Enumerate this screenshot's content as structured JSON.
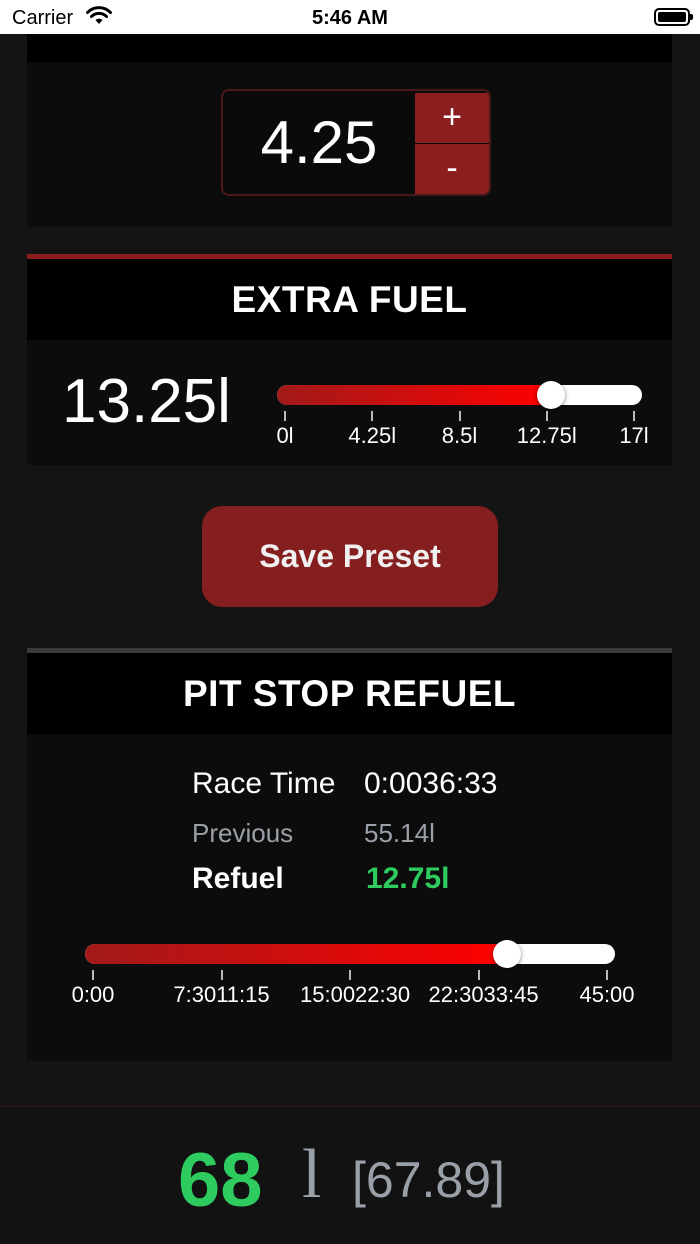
{
  "status_bar": {
    "carrier": "Carrier",
    "time": "5:46 AM"
  },
  "fuel_per_lap": {
    "value": "4.25",
    "plus_label": "+",
    "minus_label": "-"
  },
  "extra_fuel": {
    "title": "EXTRA FUEL",
    "value": "13.25l",
    "slider": {
      "min": 0,
      "max": 17,
      "current": 12.75,
      "ticks": [
        "0l",
        "4.25l",
        "8.5l",
        "12.75l",
        "17l"
      ]
    }
  },
  "save_preset": {
    "label": "Save Preset"
  },
  "pit_stop_refuel": {
    "title": "PIT STOP REFUEL",
    "race_time_label": "Race Time",
    "race_time_value": "0:0036:33",
    "previous_label": "Previous",
    "previous_value": "55.14l",
    "refuel_label": "Refuel",
    "refuel_value": "12.75l",
    "slider": {
      "min_minutes": 0,
      "max_minutes": 45,
      "current_fraction": 0.797,
      "ticks": [
        "0:00",
        "7:3011:15",
        "15:0022:30",
        "22:3033:45",
        "45:00"
      ]
    }
  },
  "footer": {
    "fuel_value": "68",
    "unit": "l",
    "exact": "[67.89]"
  },
  "colors": {
    "accent_red": "#8b1f1f",
    "green": "#2ecc5f",
    "gray_text": "#9aa0a8"
  }
}
